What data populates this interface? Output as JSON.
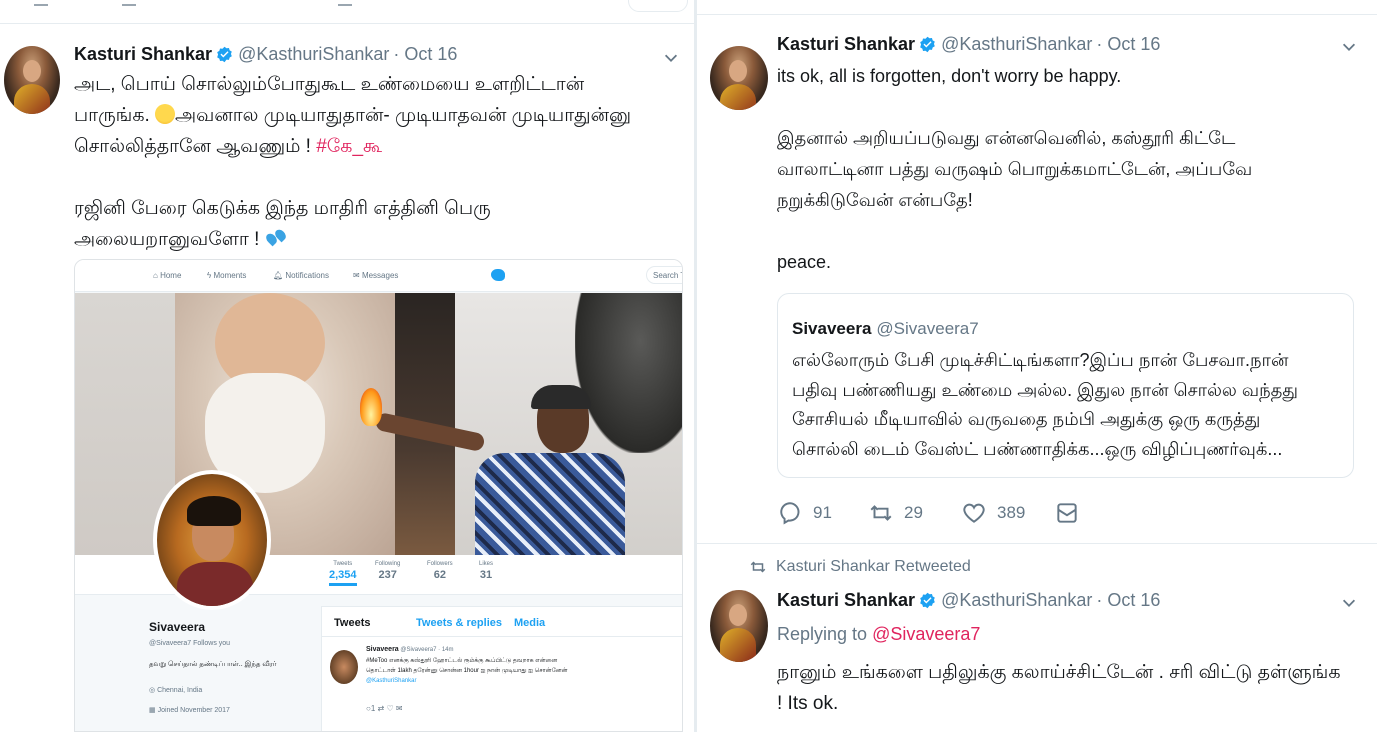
{
  "left_tweet": {
    "author_name": "Kasturi Shankar",
    "author_handle": "@KasthuriShankar",
    "date": "· Oct 16",
    "line1": "அட, பொய் சொல்லும்போதுகூட உண்மையை உளறிட்டான்",
    "line2_a": "பாருங்க.",
    "line2_b": "அவனால முடியாதுதான்-  முடியாதவன் முடியாதுன்னு",
    "line3_a": "சொல்லித்தானே ஆவணும் ! ",
    "line3_hashtag": "#கே_கூ",
    "line4": "ரஜினி பேரை கெடுக்க இந்த மாதிரி எத்தினி பெரு",
    "line5": "அலையறானுவளோ  ! ",
    "emoji_1": "grinning-sweat-emoji",
    "emoji_2": "sweat-droplets-emoji"
  },
  "embedded_screenshot": {
    "nav": {
      "home": "Home",
      "moments": "Moments",
      "notifications": "Notifications",
      "messages": "Messages",
      "search": "Search Tw"
    },
    "stats": [
      {
        "label": "Tweets",
        "value": "2,354"
      },
      {
        "label": "Following",
        "value": "237"
      },
      {
        "label": "Followers",
        "value": "62"
      },
      {
        "label": "Likes",
        "value": "31"
      }
    ],
    "profile": {
      "name": "Sivaveera",
      "handle": "@Sivaveera7",
      "follows_you": "Follows you",
      "bio": "தவறு செய்தால் தண்டிப்பாள்.. இந்த வீரர்",
      "location": "Chennai, India",
      "joined": "Joined November 2017"
    },
    "tabs": {
      "tweets": "Tweets",
      "replies": "Tweets & replies",
      "media": "Media"
    },
    "feed_tweet": {
      "name": "Sivaveera",
      "meta": "@Sivaveera7 · 14m",
      "text1": "#MeToo எனக்கு கஸ்தூரி ஹோட்டல் ரூம்க்கு கூப்பிட்டு தவறாக என்னை",
      "text2": "தொட்டாள் 1lakh தரேன்னு சொன்ன 1hour ஐ நான் முடியாது ஐ சொன்னேன்",
      "mention": "@KasthuriShankar",
      "reply_count": "1"
    }
  },
  "right_tweet": {
    "author_name": "Kasturi Shankar",
    "author_handle": "@KasthuriShankar",
    "date": "· Oct 16",
    "line1": "its ok, all is forgotten, don't worry be happy.",
    "line2": "இதனால் அறியப்படுவது என்னவெனில், கஸ்தூரி கிட்டே",
    "line3": "வாலாட்டினா பத்து வருஷம் பொறுக்கமாட்டேன், அப்பவே",
    "line4": "நறுக்கிடுவேன் என்பதே!",
    "line5": "peace.",
    "quote": {
      "name": "Sivaveera",
      "handle": "@Sivaveera7",
      "line1": "எல்லோரும் பேசி முடிச்சிட்டிங்களா?இப்ப நான் பேசவா.நான்",
      "line2": "பதிவு பண்ணியது உண்மை அல்ல. இதுல நான் சொல்ல வந்தது",
      "line3": "சோசியல் மீடியாவில் வருவதை நம்பி அதுக்கு ஒரு கருத்து",
      "line4": "சொல்லி டைம் வேஸ்ட் பண்ணாதிக்க...ஒரு விழிப்புணர்வுக்..."
    },
    "replies": "91",
    "retweets": "29",
    "likes": "389"
  },
  "retweet_item": {
    "retweeted_by": "Kasturi Shankar Retweeted",
    "author_name": "Kasturi Shankar",
    "author_handle": "@KasthuriShankar",
    "date": "· Oct 16",
    "replying_prefix": "Replying to ",
    "replying_handle": "@Sivaveera7",
    "line1": "நானும் உங்களை பதிலுக்கு கலாய்ச்சிட்டேன் . சரி விட்டு தள்ளுங்க",
    "line2": "! Its ok."
  },
  "colors": {
    "link": "#e0245e",
    "muted": "#657786",
    "twitter_blue": "#1da1f2"
  }
}
